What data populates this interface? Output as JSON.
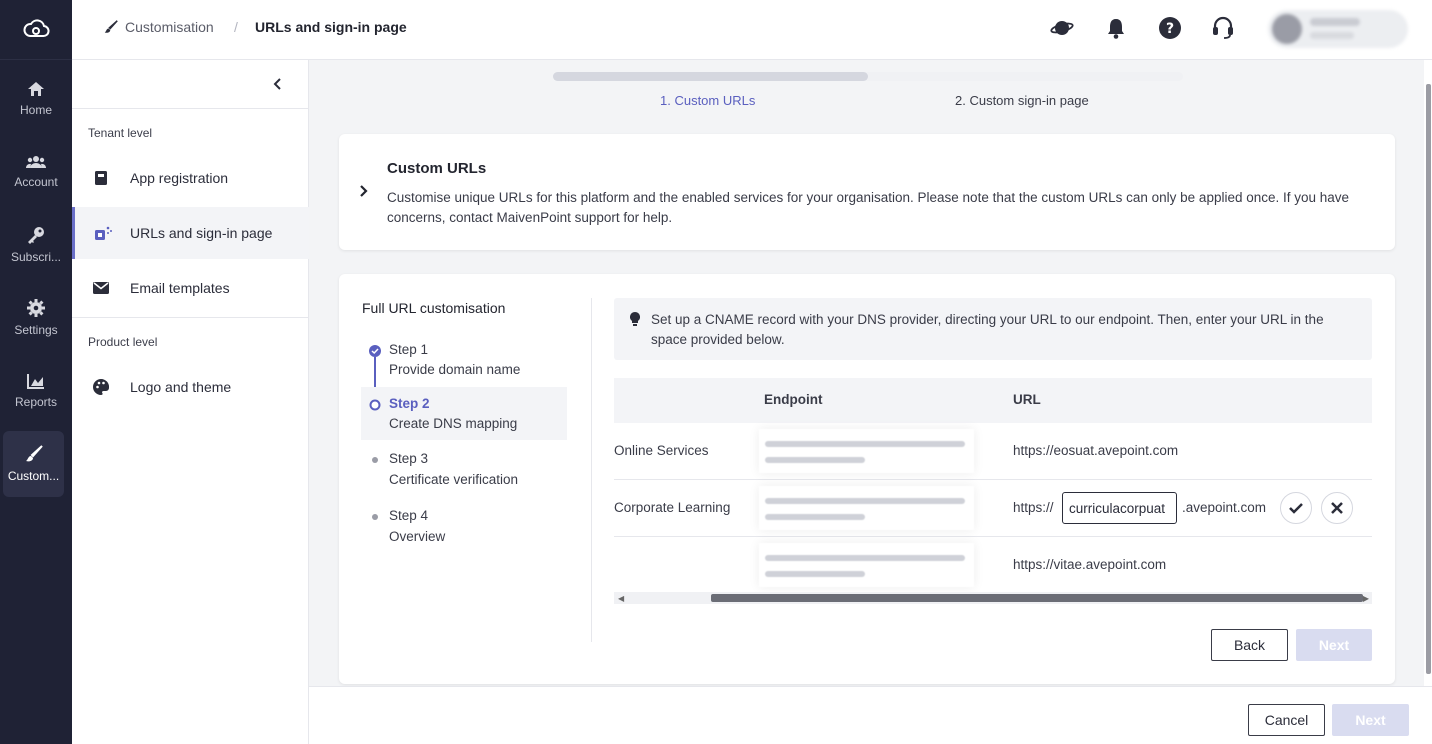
{
  "rail": {
    "items": [
      {
        "label": "Home",
        "icon": "home-icon"
      },
      {
        "label": "Account",
        "icon": "users-icon"
      },
      {
        "label": "Subscri...",
        "icon": "key-icon"
      },
      {
        "label": "Settings",
        "icon": "gear-icon"
      },
      {
        "label": "Reports",
        "icon": "chart-icon"
      },
      {
        "label": "Custom...",
        "icon": "brush-icon"
      }
    ]
  },
  "header": {
    "breadcrumb_parent": "Customisation",
    "breadcrumb_sep": "/",
    "breadcrumb_current": "URLs and sign-in page"
  },
  "sidenav": {
    "tenant_header": "Tenant level",
    "product_header": "Product level",
    "items": [
      {
        "label": "App registration",
        "icon": "book-icon"
      },
      {
        "label": "URLs and sign-in page",
        "icon": "link-icon"
      },
      {
        "label": "Email templates",
        "icon": "mail-icon"
      },
      {
        "label": "Logo and theme",
        "icon": "palette-icon"
      }
    ]
  },
  "wizard": {
    "progress": 0.5,
    "step1": "1. Custom URLs",
    "step2": "2. Custom sign-in page"
  },
  "intro": {
    "title": "Custom URLs",
    "description": "Customise unique URLs for this platform and the enabled services for your organisation. Please note that the custom URLs can only be applied once. If you have concerns, contact MaivenPoint support for help."
  },
  "panel": {
    "title": "Full URL customisation",
    "steps": [
      {
        "name": "Step 1",
        "sub": "Provide domain name"
      },
      {
        "name": "Step 2",
        "sub": "Create DNS mapping"
      },
      {
        "name": "Step 3",
        "sub": "Certificate verification"
      },
      {
        "name": "Step 4",
        "sub": "Overview"
      }
    ],
    "info": "Set up a CNAME record with your DNS provider, directing your URL to our endpoint. Then, enter your URL in the space provided below.",
    "table": {
      "col_endpoint": "Endpoint",
      "col_url": "URL",
      "rows": [
        {
          "service": "Online Services",
          "url": "https://eosuat.avepoint.com"
        },
        {
          "service": "Corporate Learning",
          "url_prefix": "https://",
          "url_value": "curriculacorpuat",
          "url_suffix": ".avepoint.com"
        },
        {
          "service": "",
          "url": "https://vitae.avepoint.com"
        }
      ]
    },
    "back_label": "Back",
    "next_label": "Next"
  },
  "footer": {
    "cancel_label": "Cancel",
    "next_label": "Next"
  },
  "colors": {
    "accent": "#5a5fbf",
    "rail_bg": "#1f2235",
    "disabled_btn": "#d9dcf0"
  }
}
